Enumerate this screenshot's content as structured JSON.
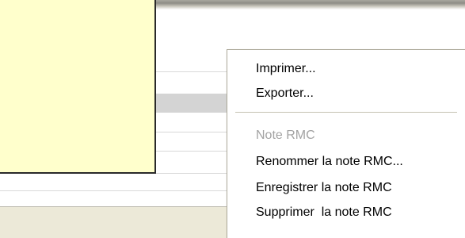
{
  "context_menu": {
    "items": [
      {
        "label": "Imprimer...",
        "enabled": true
      },
      {
        "label": "Exporter...",
        "enabled": true
      },
      {
        "label": "Note RMC",
        "enabled": false
      },
      {
        "label": "Renommer la note RMC...",
        "enabled": true
      },
      {
        "label": "Enregistrer la note RMC",
        "enabled": true
      },
      {
        "label": "Supprimer  la note RMC",
        "enabled": true
      }
    ]
  },
  "colors": {
    "note_background": "#ffffcc",
    "menu_background": "#ffffff",
    "disabled_text": "#a3a3a3",
    "selected_row": "#d4d4d4",
    "panel_background": "#ece9d8"
  }
}
